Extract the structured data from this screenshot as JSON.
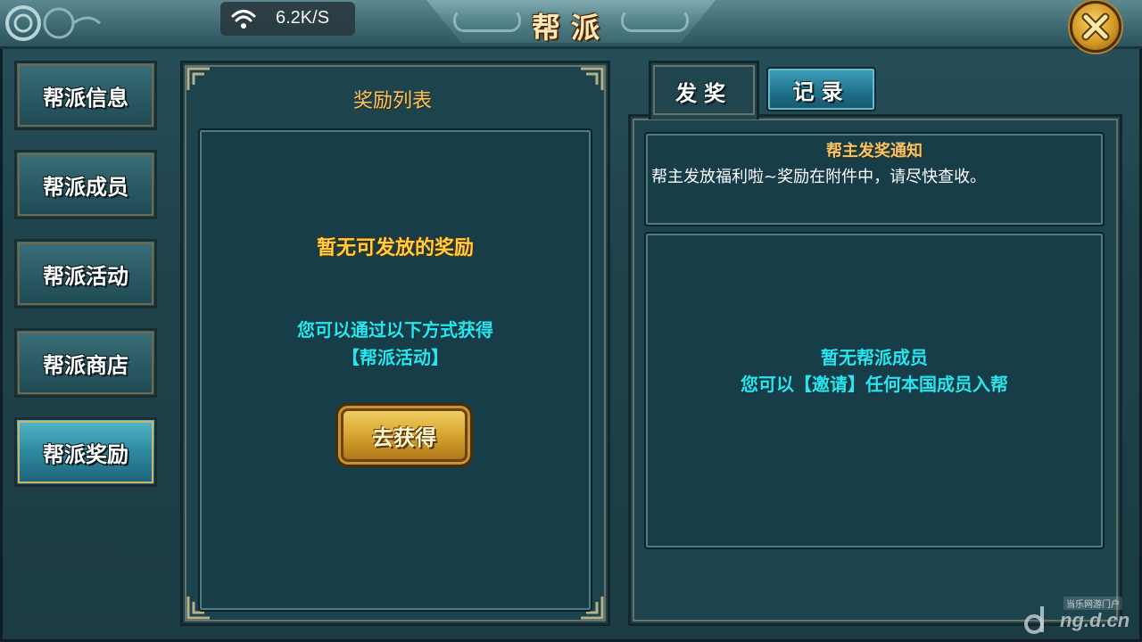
{
  "header": {
    "title": "帮派",
    "status_bar": {
      "wifi_icon": "wifi-icon",
      "network_speed": "6.2K/S"
    },
    "close_icon": "close-icon"
  },
  "sidebar": {
    "items": [
      {
        "label": "帮派信息",
        "active": false
      },
      {
        "label": "帮派成员",
        "active": false
      },
      {
        "label": "帮派活动",
        "active": false
      },
      {
        "label": "帮派商店",
        "active": false
      },
      {
        "label": "帮派奖励",
        "active": true
      }
    ]
  },
  "reward_list": {
    "title": "奖励列表",
    "empty_message": "暂无可发放的奖励",
    "hint_line1": "您可以通过以下方式获得",
    "hint_line2": "【帮派活动】",
    "get_button": "去获得"
  },
  "distribution": {
    "tabs": [
      {
        "label": "发奖",
        "active": true
      },
      {
        "label": "记录",
        "active": false
      }
    ],
    "notice_title": "帮主发奖通知",
    "notice_body": "帮主发放福利啦~奖励在附件中，请尽快查收。",
    "empty_members": "暂无帮派成员",
    "invite_hint": "您可以【邀请】任何本国成员入帮"
  },
  "watermark": {
    "label": "当乐网游门户",
    "url": "ng.d.cn"
  },
  "colors": {
    "accent_gold": "#ffcf40",
    "accent_cyan": "#27e6f0",
    "panel_bg": "#1d434d",
    "active_tab_blue": "#2d8aa0"
  }
}
